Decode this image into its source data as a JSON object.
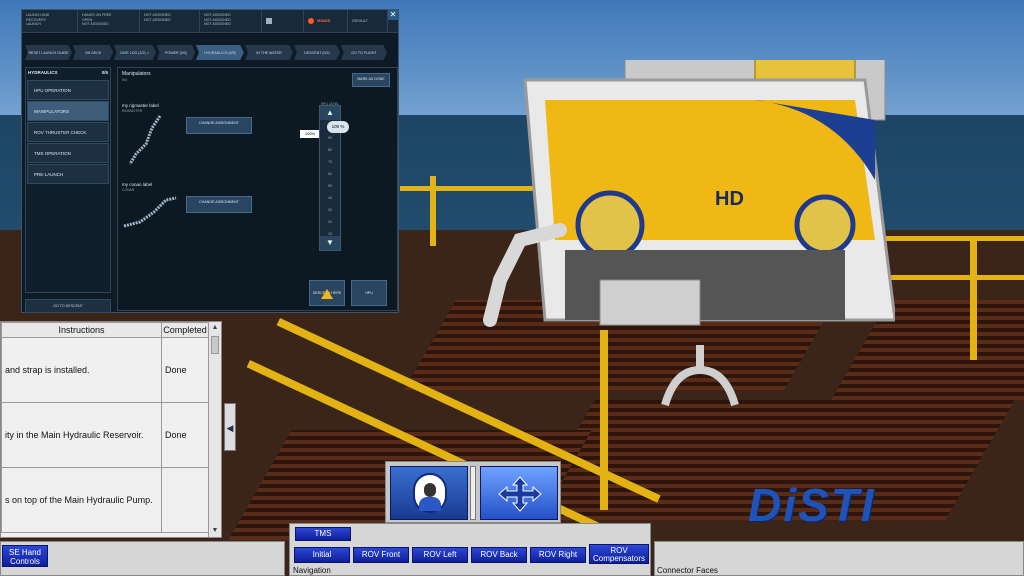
{
  "panel": {
    "topbar": {
      "cells": [
        {
          "line1": "LAUNCH AND",
          "line2": "RECOVERY",
          "line3": "LAUNCH"
        },
        {
          "line1": "HANDS ON FREE",
          "line2": "OPEN",
          "line3": "NOT ASSIGNED"
        },
        {
          "line1": "NOT ASSIGNED",
          "line2": "NOT ASSIGNED",
          "line3": ""
        },
        {
          "line1": "NOT ASSIGNED",
          "line2": "NOT ASSIGNED",
          "line3": "NOT ASSIGNED"
        }
      ],
      "issues_label": "ISSUES",
      "default_label": "DEFAULT",
      "close_label": "✕"
    },
    "steps": [
      "RESET LAUNCH GUIDE",
      "ON DECK",
      "DIVE LOG (2/2) ✓",
      "POWER (0/0)",
      "HYDRAULICS (0/5)",
      "IN THE WATER",
      "DESCENT (0/2)",
      "GO TO FLIGHT"
    ],
    "sidebar": {
      "title": "HYDRAULICS",
      "count": "0/5",
      "items": [
        "HPU OPERATION",
        "MANIPULATORS",
        "ROV THRUSTER CHECK",
        "TMS OPERATION",
        "PRE-LAUNCH"
      ],
      "go_to_descent": "GO TO DESCENT"
    },
    "main": {
      "heading": "Manipulators",
      "subheading": "0/4",
      "mark_done": "MARK AS DONE",
      "arm1_label": "my rigmaster label",
      "arm1_sub": "RIGMASTER",
      "arm2_label": "my conan label",
      "arm2_sub": "CONAN",
      "change_assignment": "CHANGE ASSIGNMENT",
      "slider_title": "HPU LEVEL",
      "slider_ticks": [
        "100",
        "90",
        "80",
        "70",
        "60",
        "50",
        "40",
        "30",
        "20",
        "10"
      ],
      "pct_small": "100%",
      "pct_large": "100 %",
      "bottom_btn1": "DESCEND HERE",
      "bottom_btn2": "HPU"
    }
  },
  "instructions": {
    "headers": [
      "Instructions",
      "Completed"
    ],
    "rows": [
      {
        "text": "and strap is installed.",
        "status": "Done"
      },
      {
        "text": "ity in the Main Hydraulic Reservoir.",
        "status": "Done"
      },
      {
        "text": "s on top of the Main Hydraulic Pump.",
        "status": ""
      }
    ],
    "collapse_icon": "◀"
  },
  "bottom": {
    "left_btn": "SE Hand Controls",
    "tms_btn": "TMS",
    "nav_buttons": [
      "Initial",
      "ROV Front",
      "ROV Left",
      "ROV Back",
      "ROV Right",
      "ROV Compensators"
    ],
    "nav_label": "Navigation",
    "connector_label": "Connector Faces"
  },
  "logo_text": "DiSTI",
  "colors": {
    "accent": "#1f53b7",
    "deck_yellow": "#e2b312",
    "button_blue": "#1f35c0"
  }
}
